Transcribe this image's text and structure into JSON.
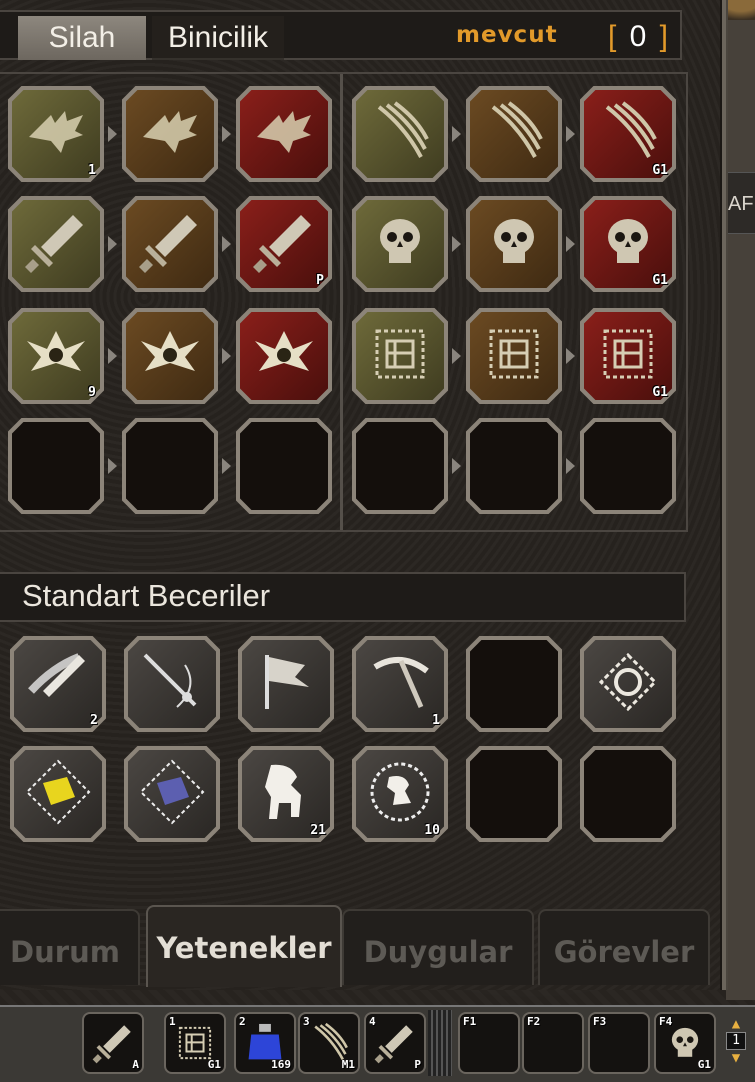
{
  "header": {
    "tabs": [
      {
        "label": "Silah"
      },
      {
        "label": "Binicilik"
      }
    ],
    "points_label": "mevcut",
    "points_value": "0"
  },
  "right_edge_text": "AF",
  "skill_grid": {
    "left_rows": [
      [
        {
          "icon": "wing-icon",
          "tone": "olive",
          "badge": "1"
        },
        {
          "icon": "wing-icon",
          "tone": "brown",
          "badge": ""
        },
        {
          "icon": "wing-icon",
          "tone": "red",
          "badge": ""
        }
      ],
      [
        {
          "icon": "sword-icon",
          "tone": "olive",
          "badge": ""
        },
        {
          "icon": "sword-icon",
          "tone": "brown",
          "badge": ""
        },
        {
          "icon": "sword-icon",
          "tone": "red",
          "badge": "P"
        }
      ],
      [
        {
          "icon": "crest-icon",
          "tone": "olive",
          "badge": "9"
        },
        {
          "icon": "crest-icon",
          "tone": "brown",
          "badge": ""
        },
        {
          "icon": "crest-icon",
          "tone": "red",
          "badge": ""
        }
      ],
      [
        {
          "icon": "",
          "tone": "empty",
          "badge": ""
        },
        {
          "icon": "",
          "tone": "empty",
          "badge": ""
        },
        {
          "icon": "",
          "tone": "empty",
          "badge": ""
        }
      ]
    ],
    "right_rows": [
      [
        {
          "icon": "claw-icon",
          "tone": "olive",
          "badge": ""
        },
        {
          "icon": "claw-icon",
          "tone": "brown",
          "badge": ""
        },
        {
          "icon": "claw-icon",
          "tone": "red",
          "badge": "G1"
        }
      ],
      [
        {
          "icon": "skull-icon",
          "tone": "olive",
          "badge": ""
        },
        {
          "icon": "skull-icon",
          "tone": "brown",
          "badge": ""
        },
        {
          "icon": "skull-icon",
          "tone": "red",
          "badge": "G1"
        }
      ],
      [
        {
          "icon": "rune-icon",
          "tone": "olive",
          "badge": ""
        },
        {
          "icon": "rune-icon",
          "tone": "brown",
          "badge": ""
        },
        {
          "icon": "rune-icon",
          "tone": "red",
          "badge": "G1"
        }
      ],
      [
        {
          "icon": "",
          "tone": "empty",
          "badge": ""
        },
        {
          "icon": "",
          "tone": "empty",
          "badge": ""
        },
        {
          "icon": "",
          "tone": "empty",
          "badge": ""
        }
      ]
    ]
  },
  "standard_skills": {
    "title": "Standart Beceriler",
    "rows": [
      [
        {
          "icon": "combo-sword-icon",
          "badge": "2"
        },
        {
          "icon": "fishing-rod-icon",
          "badge": ""
        },
        {
          "icon": "flag-icon",
          "badge": ""
        },
        {
          "icon": "pickaxe-icon",
          "badge": "1"
        },
        {
          "icon": "",
          "badge": ""
        },
        {
          "icon": "knot-icon",
          "badge": ""
        }
      ],
      [
        {
          "icon": "yellow-book-icon",
          "badge": ""
        },
        {
          "icon": "blue-book-icon",
          "badge": ""
        },
        {
          "icon": "horse-icon",
          "badge": "21"
        },
        {
          "icon": "horse-medal-icon",
          "badge": "10"
        },
        {
          "icon": "",
          "badge": ""
        },
        {
          "icon": "",
          "badge": ""
        }
      ]
    ]
  },
  "bottom_tabs": [
    {
      "label": "Durum",
      "active": false
    },
    {
      "label": "Yetenekler",
      "active": true
    },
    {
      "label": "Duygular",
      "active": false
    },
    {
      "label": "Görevler",
      "active": false
    }
  ],
  "hotbar": {
    "slots": [
      {
        "num": "",
        "icon": "sword-icon",
        "count": "A"
      },
      {
        "num": "1",
        "icon": "rune-icon",
        "count": "G1"
      },
      {
        "num": "2",
        "icon": "blue-potion-icon",
        "count": "169"
      },
      {
        "num": "3",
        "icon": "claw-icon",
        "count": "M1"
      },
      {
        "num": "4",
        "icon": "sword-icon",
        "count": "P"
      },
      {
        "num": "F1",
        "icon": "",
        "count": ""
      },
      {
        "num": "F2",
        "icon": "",
        "count": ""
      },
      {
        "num": "F3",
        "icon": "",
        "count": ""
      },
      {
        "num": "F4",
        "icon": "skull-icon",
        "count": "G1"
      }
    ],
    "page": "1"
  }
}
